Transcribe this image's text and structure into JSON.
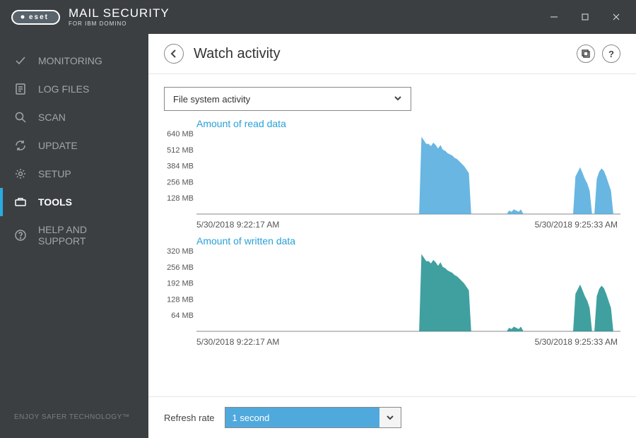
{
  "titlebar": {
    "brand_pill_text": "eset",
    "brand_main": "MAIL SECURITY",
    "brand_sub": "FOR IBM DOMINO"
  },
  "sidebar": {
    "items": [
      {
        "label": "MONITORING"
      },
      {
        "label": "LOG FILES"
      },
      {
        "label": "SCAN"
      },
      {
        "label": "UPDATE"
      },
      {
        "label": "SETUP"
      },
      {
        "label": "TOOLS"
      },
      {
        "label": "HELP AND SUPPORT"
      }
    ],
    "footer": "ENJOY SAFER TECHNOLOGY™"
  },
  "header": {
    "title": "Watch activity",
    "help_symbol": "?"
  },
  "activity_select": {
    "value": "File system activity"
  },
  "footer": {
    "label": "Refresh rate",
    "value": "1 second"
  },
  "chart_data": [
    {
      "type": "area",
      "title": "Amount of read data",
      "x_start_label": "5/30/2018 9:22:17 AM",
      "x_end_label": "5/30/2018 9:25:33 AM",
      "y_ticks": [
        "640 MB",
        "512 MB",
        "384 MB",
        "256 MB",
        "128 MB"
      ],
      "y_max": 700,
      "series": [
        {
          "name": "read",
          "color": "#4fa9dd",
          "values": [
            0,
            0,
            0,
            0,
            0,
            0,
            0,
            0,
            0,
            0,
            0,
            0,
            0,
            0,
            0,
            0,
            0,
            0,
            0,
            0,
            0,
            0,
            0,
            0,
            0,
            0,
            0,
            0,
            0,
            0,
            0,
            0,
            0,
            0,
            0,
            0,
            0,
            0,
            0,
            0,
            0,
            0,
            0,
            0,
            0,
            0,
            0,
            0,
            0,
            0,
            0,
            0,
            0,
            0,
            0,
            0,
            0,
            0,
            0,
            0,
            0,
            0,
            0,
            0,
            0,
            0,
            0,
            0,
            0,
            0,
            0,
            0,
            0,
            0,
            0,
            0,
            0,
            0,
            0,
            0,
            0,
            0,
            0,
            0,
            0,
            0,
            0,
            0,
            0,
            0,
            0,
            0,
            0,
            0,
            0,
            660,
            630,
            600,
            600,
            580,
            610,
            590,
            560,
            590,
            550,
            540,
            520,
            510,
            500,
            480,
            470,
            450,
            430,
            410,
            380,
            350,
            0,
            0,
            0,
            0,
            0,
            0,
            0,
            0,
            0,
            0,
            0,
            0,
            0,
            0,
            0,
            0,
            30,
            20,
            40,
            30,
            20,
            40,
            0,
            0,
            0,
            0,
            0,
            0,
            0,
            0,
            0,
            0,
            0,
            0,
            0,
            0,
            0,
            0,
            0,
            0,
            0,
            0,
            0,
            0,
            320,
            360,
            400,
            350,
            300,
            260,
            200,
            0,
            0,
            300,
            360,
            390,
            370,
            320,
            260,
            200,
            0,
            0,
            0,
            0
          ]
        }
      ]
    },
    {
      "type": "area",
      "title": "Amount of written data",
      "x_start_label": "5/30/2018 9:22:17 AM",
      "x_end_label": "5/30/2018 9:25:33 AM",
      "y_ticks": [
        "320 MB",
        "256 MB",
        "192 MB",
        "128 MB",
        "64 MB"
      ],
      "y_max": 350,
      "series": [
        {
          "name": "written",
          "color": "#1e8f8f",
          "values": [
            0,
            0,
            0,
            0,
            0,
            0,
            0,
            0,
            0,
            0,
            0,
            0,
            0,
            0,
            0,
            0,
            0,
            0,
            0,
            0,
            0,
            0,
            0,
            0,
            0,
            0,
            0,
            0,
            0,
            0,
            0,
            0,
            0,
            0,
            0,
            0,
            0,
            0,
            0,
            0,
            0,
            0,
            0,
            0,
            0,
            0,
            0,
            0,
            0,
            0,
            0,
            0,
            0,
            0,
            0,
            0,
            0,
            0,
            0,
            0,
            0,
            0,
            0,
            0,
            0,
            0,
            0,
            0,
            0,
            0,
            0,
            0,
            0,
            0,
            0,
            0,
            0,
            0,
            0,
            0,
            0,
            0,
            0,
            0,
            0,
            0,
            0,
            0,
            0,
            0,
            0,
            0,
            0,
            0,
            0,
            330,
            315,
            300,
            300,
            290,
            305,
            295,
            280,
            295,
            275,
            270,
            260,
            255,
            250,
            240,
            235,
            225,
            215,
            205,
            190,
            175,
            0,
            0,
            0,
            0,
            0,
            0,
            0,
            0,
            0,
            0,
            0,
            0,
            0,
            0,
            0,
            0,
            15,
            10,
            20,
            15,
            10,
            20,
            0,
            0,
            0,
            0,
            0,
            0,
            0,
            0,
            0,
            0,
            0,
            0,
            0,
            0,
            0,
            0,
            0,
            0,
            0,
            0,
            0,
            0,
            160,
            180,
            200,
            175,
            150,
            130,
            100,
            0,
            0,
            150,
            180,
            195,
            185,
            160,
            130,
            100,
            0,
            0,
            0,
            0
          ]
        }
      ]
    }
  ]
}
